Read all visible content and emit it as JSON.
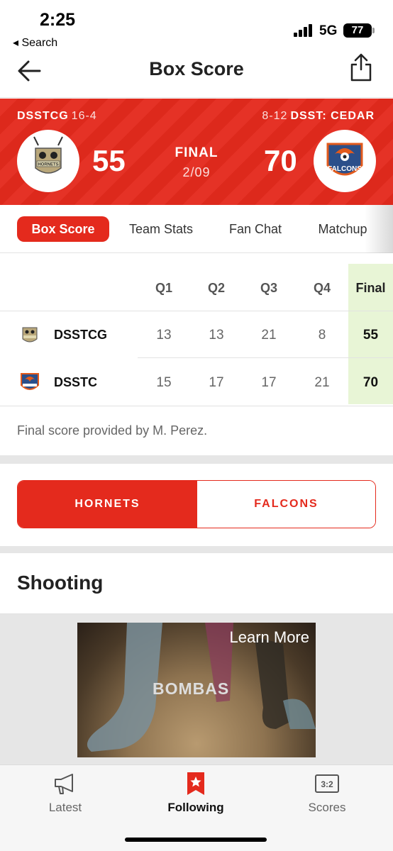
{
  "status_bar": {
    "time": "2:25",
    "back_label": "◂ Search",
    "network": "5G",
    "battery": "77"
  },
  "header": {
    "title": "Box Score",
    "back_icon": "back-arrow-icon",
    "share_icon": "share-icon"
  },
  "game": {
    "home": {
      "abbr": "DSSTCG",
      "record": "16-4",
      "score": "55",
      "logo_text": "HORNETS"
    },
    "away": {
      "abbr": "DSST: CEDAR",
      "record": "8-12",
      "score": "70",
      "logo_text": "FALCONS"
    },
    "status": "FINAL",
    "date": "2/09"
  },
  "tabs": [
    {
      "label": "Box Score",
      "active": true
    },
    {
      "label": "Team Stats",
      "active": false
    },
    {
      "label": "Fan Chat",
      "active": false
    },
    {
      "label": "Matchup",
      "active": false
    }
  ],
  "box_score": {
    "headers": [
      "Q1",
      "Q2",
      "Q3",
      "Q4",
      "Final"
    ],
    "rows": [
      {
        "team": "DSSTCG",
        "quarters": [
          "13",
          "13",
          "21",
          "8"
        ],
        "final": "55"
      },
      {
        "team": "DSSTC",
        "quarters": [
          "15",
          "17",
          "17",
          "21"
        ],
        "final": "70"
      }
    ],
    "footnote": "Final score provided by M. Perez."
  },
  "team_toggle": {
    "options": [
      "HORNETS",
      "FALCONS"
    ],
    "selected": "HORNETS"
  },
  "section_title": "Shooting",
  "ad": {
    "cta": "Learn More",
    "brand": "BOMBAS"
  },
  "tab_bar": [
    {
      "label": "Latest",
      "icon": "megaphone-icon",
      "active": false
    },
    {
      "label": "Following",
      "icon": "star-bookmark-icon",
      "active": true
    },
    {
      "label": "Scores",
      "icon": "scoreboard-icon",
      "active": false
    }
  ],
  "colors": {
    "brand_red": "#e42a1d",
    "final_col": "#e8f5d6"
  }
}
